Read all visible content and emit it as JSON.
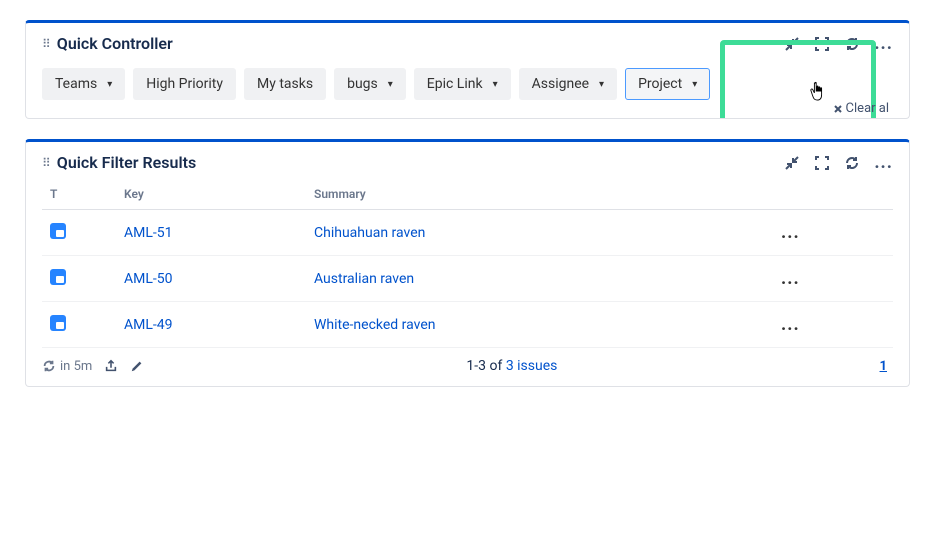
{
  "controller": {
    "title": "Quick Controller",
    "filters": {
      "teams": "Teams",
      "high_priority": "High Priority",
      "my_tasks": "My tasks",
      "bugs": "bugs",
      "epic_link": "Epic Link",
      "assignee": "Assignee",
      "project": "Project"
    },
    "clear_all": "Clear al"
  },
  "results": {
    "title": "Quick Filter Results",
    "columns": {
      "type": "T",
      "key": "Key",
      "summary": "Summary"
    },
    "rows": [
      {
        "key": "AML-51",
        "summary": "Chihuahuan raven"
      },
      {
        "key": "AML-50",
        "summary": "Australian raven"
      },
      {
        "key": "AML-49",
        "summary": "White-necked raven"
      }
    ],
    "row_actions": "...",
    "footer": {
      "refresh_in": "in 5m",
      "range": "1-3 of ",
      "total_link": "3 issues",
      "page": "1"
    }
  }
}
